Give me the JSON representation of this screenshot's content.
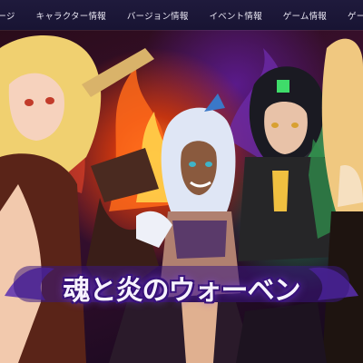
{
  "nav": {
    "items": [
      "ムページ",
      "キャラクター情報",
      "バージョン情報",
      "イベント情報",
      "ゲーム情報",
      "ゲームの特徴"
    ]
  },
  "banner": {
    "title": "魂と炎のウォーベン"
  },
  "colors": {
    "nav_bg": "#1c1838",
    "title_glow": "#8c4dff",
    "fire": "#ff6a1a",
    "green_flame": "#3fdc6a"
  }
}
